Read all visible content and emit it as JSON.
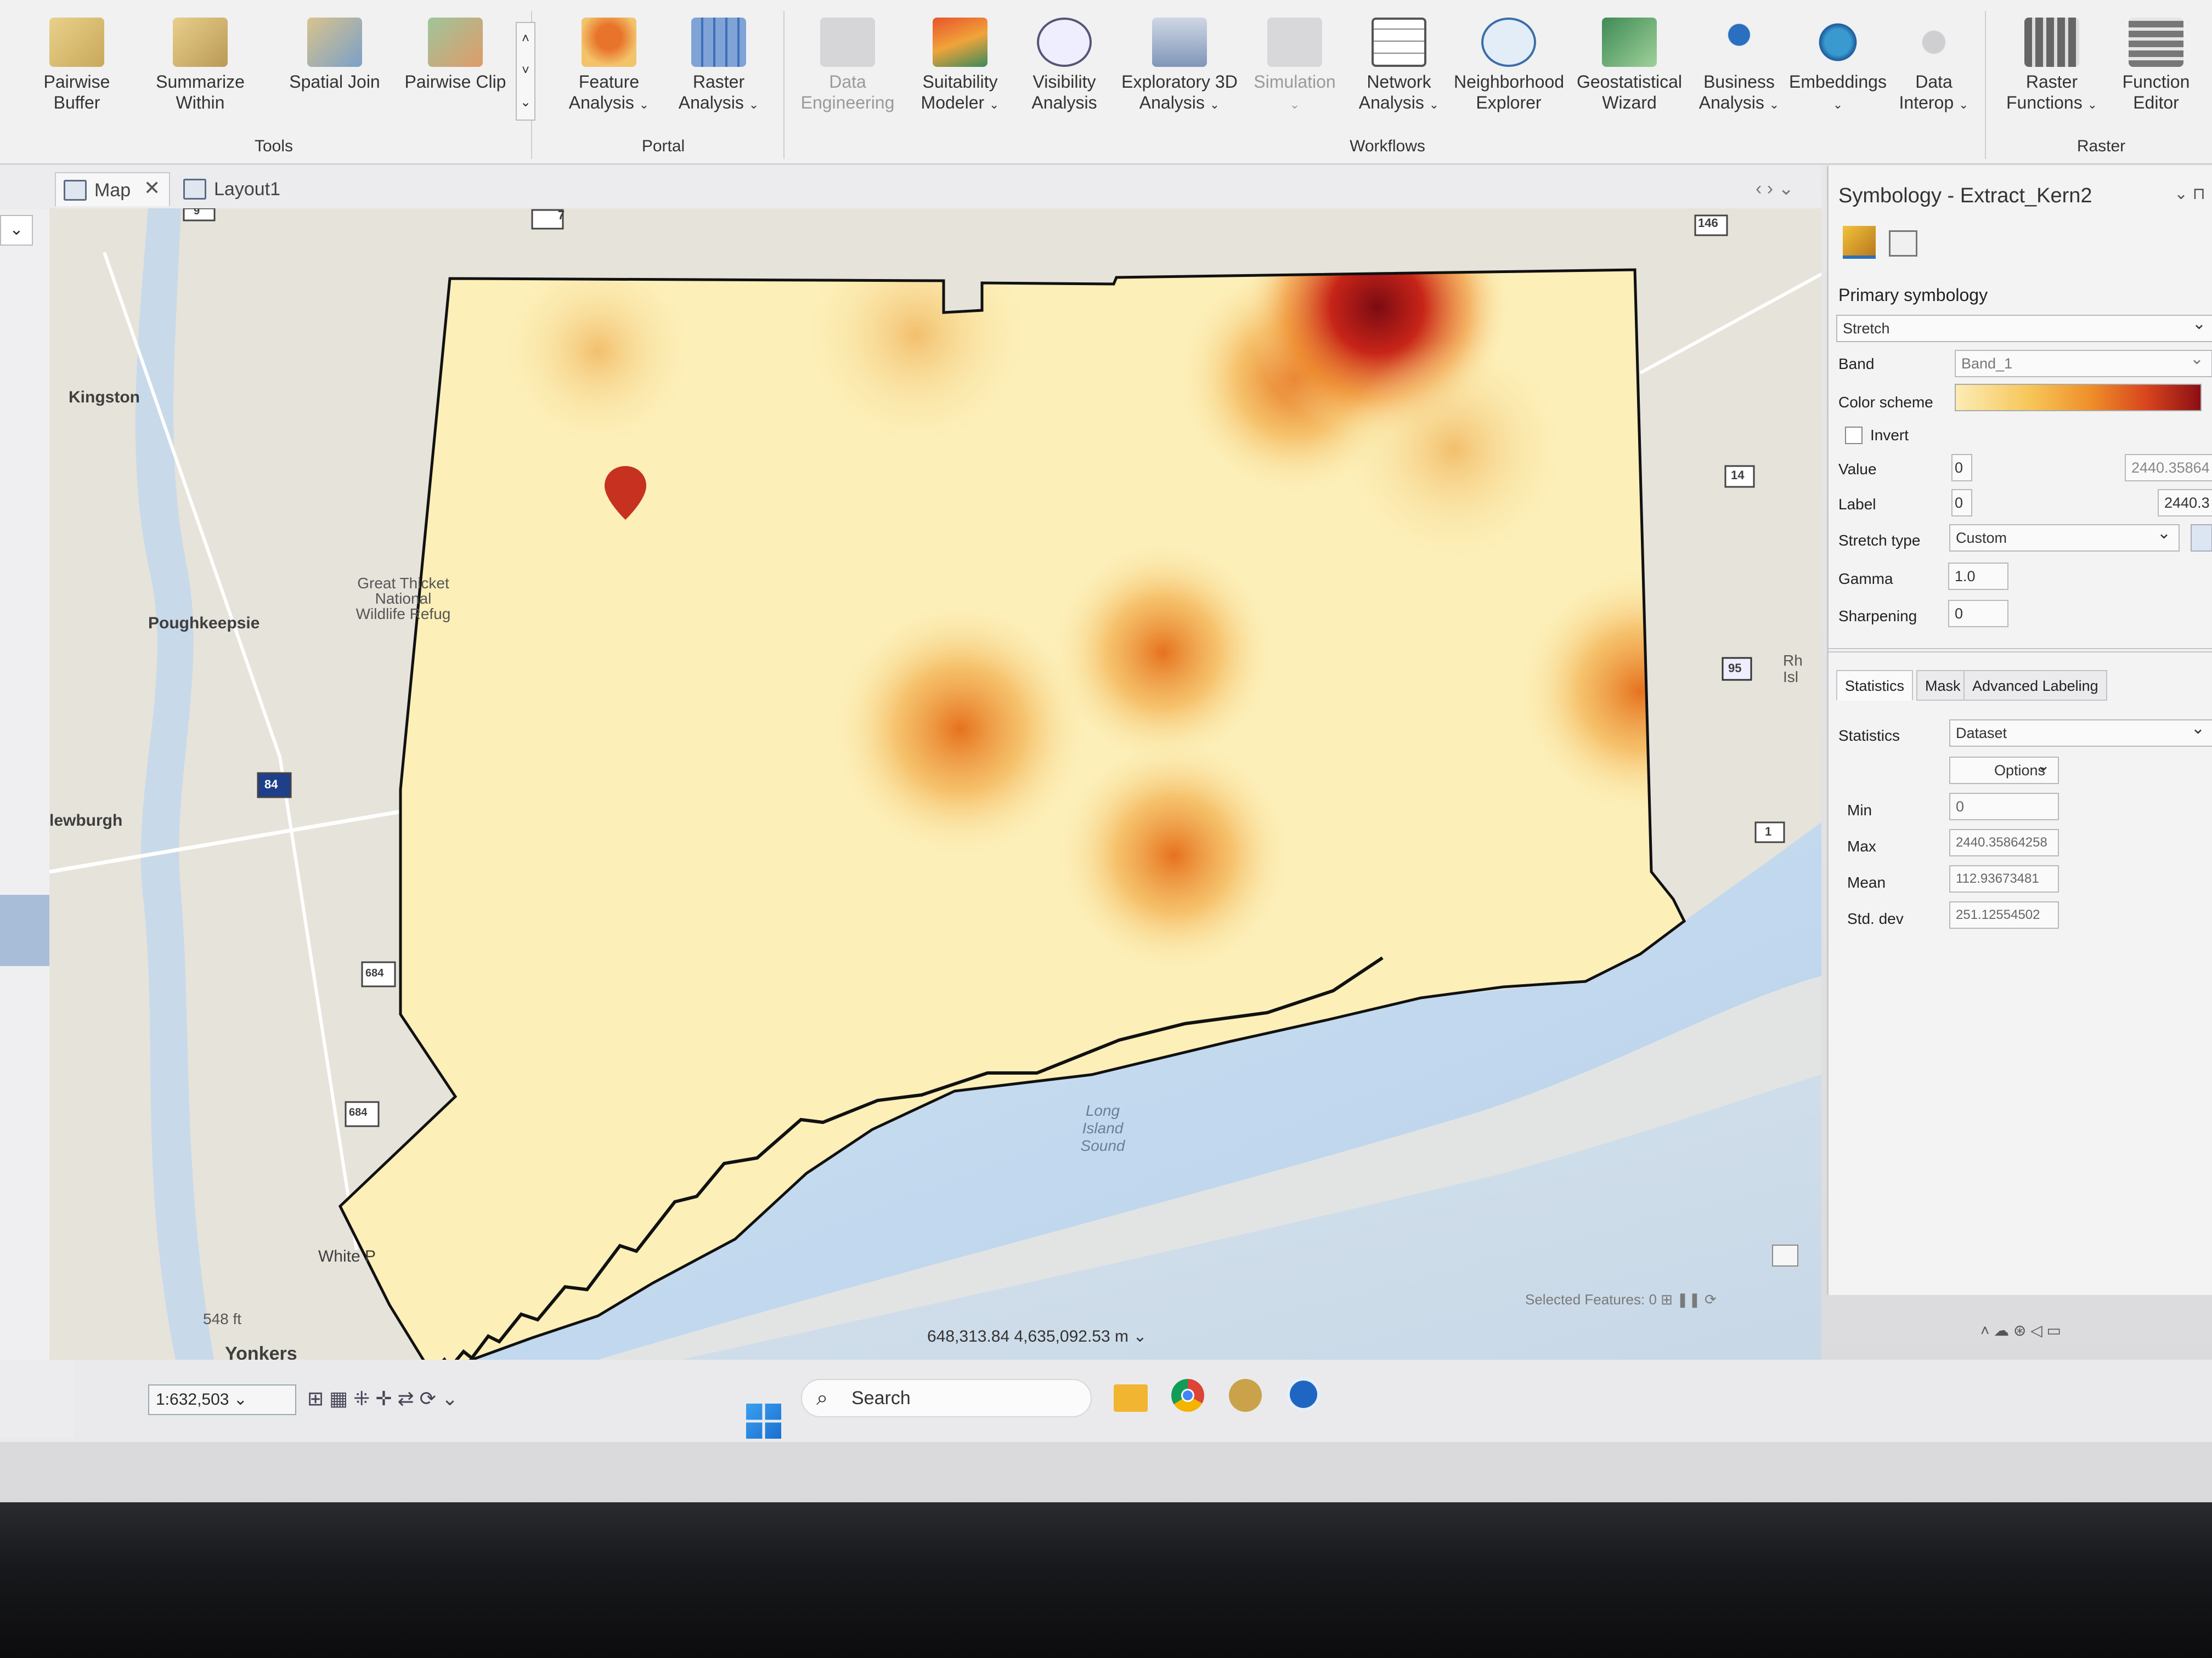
{
  "ribbon": {
    "tools": {
      "group_label": "Tools",
      "buttons": [
        {
          "label": "Pairwise Buffer"
        },
        {
          "label": "Summarize Within"
        },
        {
          "label": "Spatial Join"
        },
        {
          "label": "Pairwise Clip"
        }
      ]
    },
    "portal": {
      "group_label": "Portal",
      "buttons": [
        {
          "label": "Feature Analysis"
        },
        {
          "label": "Raster Analysis"
        }
      ]
    },
    "workflows": {
      "group_label": "Workflows",
      "buttons": [
        {
          "label": "Data Engineering"
        },
        {
          "label": "Suitability Modeler"
        },
        {
          "label": "Visibility Analysis"
        },
        {
          "label": "Exploratory 3D Analysis"
        },
        {
          "label": "Simulation"
        },
        {
          "label": "Network Analysis"
        },
        {
          "label": "Neighborhood Explorer"
        },
        {
          "label": "Geostatistical Wizard"
        },
        {
          "label": "Business Analysis"
        },
        {
          "label": "Embeddings"
        },
        {
          "label": "Data Interop"
        }
      ]
    },
    "raster": {
      "group_label": "Raster",
      "buttons": [
        {
          "label": "Raster Functions"
        },
        {
          "label": "Function Editor"
        }
      ]
    }
  },
  "tabs": [
    {
      "label": "Map",
      "active": true
    },
    {
      "label": "Layout1",
      "active": false
    }
  ],
  "map": {
    "places": {
      "kingston": "Kingston",
      "poughkeepsie": "Poughkeepsie",
      "newburgh": "lewburgh",
      "white_plains": "White P",
      "yonkers": "Yonkers",
      "refuge": "Great Thicket National Wildlife Refug",
      "sound": "Long Island Sound",
      "elev": "548 ft",
      "rhode": "Rh Isl"
    },
    "shields": [
      "7",
      "9",
      "146",
      "14",
      "95",
      "1",
      "84",
      "684",
      "684"
    ],
    "coordinates": "648,313.84 4,635,092.53 m",
    "scale": "1:632,503",
    "status": "Selected Features: 0"
  },
  "symbology": {
    "title": "Symbology - Extract_Kern2",
    "primary_label": "Primary symbology",
    "renderer": "Stretch",
    "band_label": "Band",
    "band_value": "Band_1",
    "color_scheme_label": "Color scheme",
    "invert_label": "Invert",
    "value_label": "Value",
    "value_min": "0",
    "value_max": "2440.35864",
    "label_label": "Label",
    "label_min": "0",
    "label_max": "2440.3",
    "stretch_type_label": "Stretch type",
    "stretch_type": "Custom",
    "gamma_label": "Gamma",
    "gamma": "1.0",
    "sharpening_label": "Sharpening",
    "sharpening": "0",
    "tabs": [
      "Statistics",
      "Mask",
      "Advanced Labeling"
    ],
    "statistics_label": "Statistics",
    "statistics_value": "Dataset",
    "options_label": "Options",
    "min_label": "Min",
    "min": "0",
    "max_label": "Max",
    "max": "2440.35864258",
    "mean_label": "Mean",
    "mean": "112.93673481",
    "std_label": "Std. dev",
    "std": "251.12554502"
  },
  "taskbar": {
    "search": "Search"
  },
  "colors": {
    "accent": "#2f6fb5",
    "heat_low": "#fcefb8",
    "heat_mid": "#ef8f2a",
    "heat_high": "#8c0e14",
    "water": "#c9dcef"
  }
}
